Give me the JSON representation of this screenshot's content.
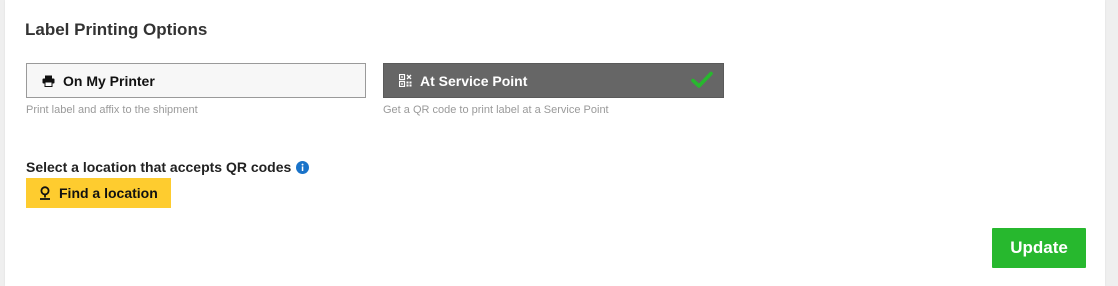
{
  "section": {
    "title": "Label Printing Options"
  },
  "options": [
    {
      "label": "On My Printer",
      "hint": "Print label and affix to the shipment",
      "icon": "printer-icon",
      "selected": false
    },
    {
      "label": "At Service Point",
      "hint": "Get a QR code to print label at a Service Point",
      "icon": "qr-code-icon",
      "selected": true
    }
  ],
  "location": {
    "prompt": "Select a location that accepts QR codes",
    "info_icon": "info-icon",
    "find_label": "Find a location",
    "find_icon": "map-pin-icon"
  },
  "actions": {
    "update_label": "Update"
  },
  "colors": {
    "selected_bg": "#666666",
    "check": "#27b82e",
    "find_bg": "#fecc2f",
    "update_bg": "#27b82e",
    "info": "#1a73c9"
  }
}
